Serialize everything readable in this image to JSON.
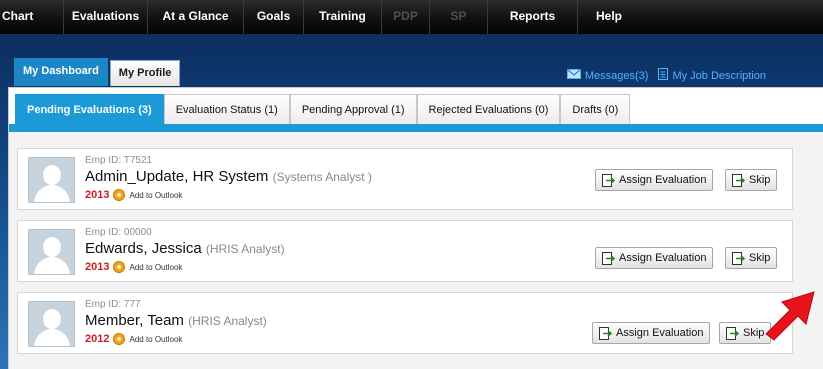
{
  "topnav": {
    "items": [
      {
        "label": "Chart",
        "enabled": true
      },
      {
        "label": "Evaluations",
        "enabled": true
      },
      {
        "label": "At a Glance",
        "enabled": true
      },
      {
        "label": "Goals",
        "enabled": true
      },
      {
        "label": "Training",
        "enabled": true
      },
      {
        "label": "PDP",
        "enabled": false
      },
      {
        "label": "SP",
        "enabled": false
      },
      {
        "label": "Reports",
        "enabled": true
      },
      {
        "label": "Help",
        "enabled": true
      }
    ]
  },
  "main_tabs": [
    {
      "label": "My Dashboard",
      "active": true
    },
    {
      "label": "My Profile",
      "active": false
    }
  ],
  "top_links": {
    "messages": "Messages(3)",
    "job_description": "My Job Description"
  },
  "sub_tabs": [
    {
      "label": "Pending Evaluations (3)",
      "active": true
    },
    {
      "label": "Evaluation Status (1)",
      "active": false
    },
    {
      "label": "Pending Approval (1)",
      "active": false
    },
    {
      "label": "Rejected Evaluations (0)",
      "active": false
    },
    {
      "label": "Drafts (0)",
      "active": false
    }
  ],
  "employees": [
    {
      "emp_id": "Emp ID: T7521",
      "name": "Admin_Update, HR System",
      "title": "(Systems Analyst )",
      "year": "2013",
      "outlook_label": "Add to Outlook",
      "assign_label": "Assign Evaluation",
      "skip_label": "Skip"
    },
    {
      "emp_id": "Emp ID: 00000",
      "name": "Edwards, Jessica",
      "title": "(HRIS Analyst)",
      "year": "2013",
      "outlook_label": "Add to Outlook",
      "assign_label": "Assign Evaluation",
      "skip_label": "Skip"
    },
    {
      "emp_id": "Emp ID: 777",
      "name": "Member, Team",
      "title": "(HRIS Analyst)",
      "year": "2012",
      "outlook_label": "Add to Outlook",
      "assign_label": "Assign Evaluation",
      "skip_label": "Skip"
    }
  ],
  "colors": {
    "accent": "#1c9ad8",
    "year": "#c8201e",
    "link": "#4fb3ff",
    "annotation_arrow": "#e8141b"
  }
}
